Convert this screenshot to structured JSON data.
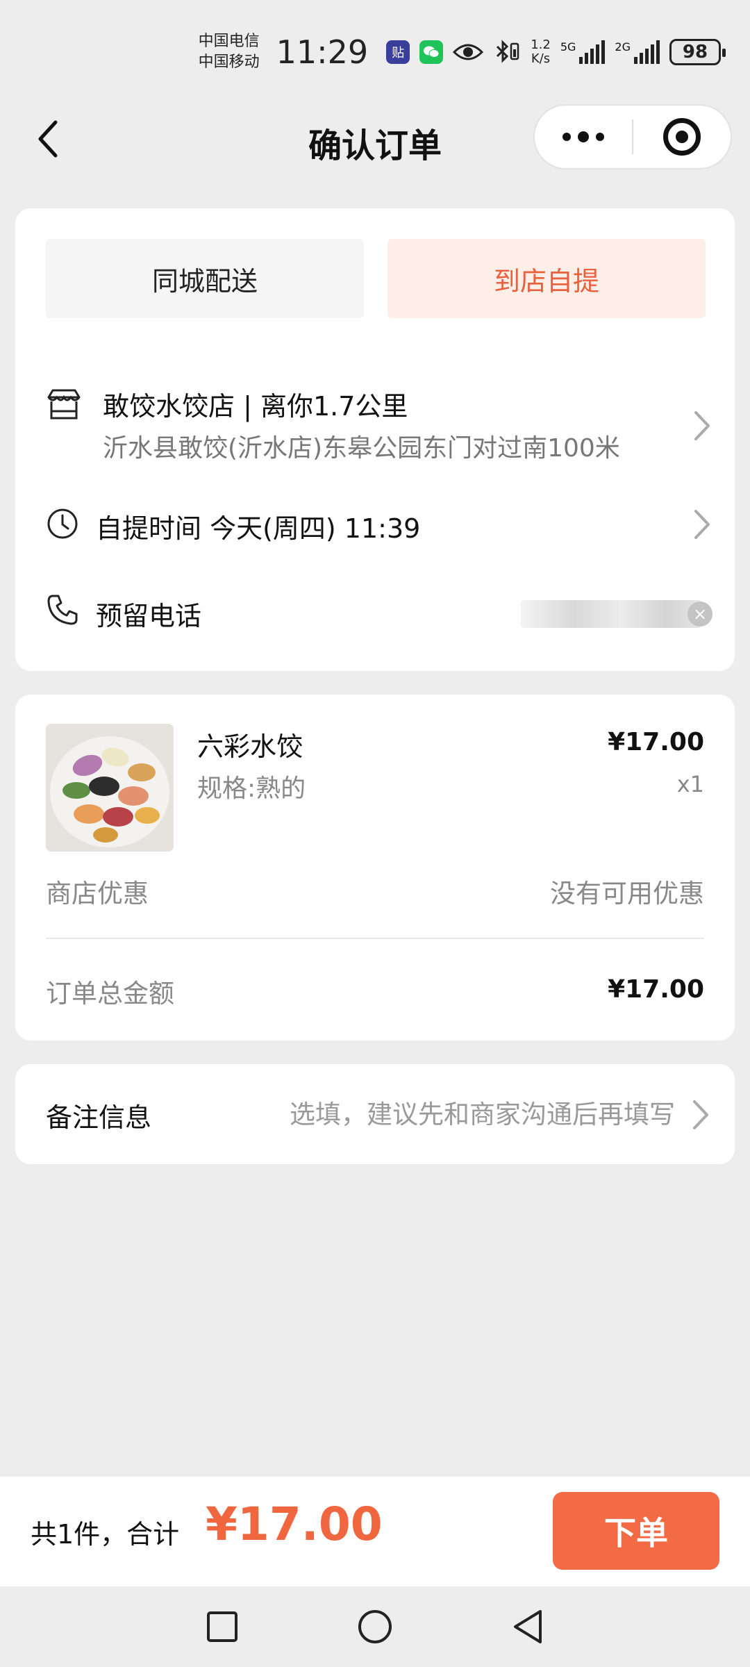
{
  "status_bar": {
    "carrier_1": "中国电信",
    "carrier_2": "中国移动",
    "time": "11:29",
    "app_badge_1": "贴",
    "net_speed_value": "1.2",
    "net_speed_unit": "K/s",
    "signal_1_tag": "5G",
    "signal_2_tag": "2G",
    "battery": "98"
  },
  "nav": {
    "title": "确认订单"
  },
  "delivery": {
    "tabs": [
      {
        "label": "同城配送",
        "active": false
      },
      {
        "label": "到店自提",
        "active": true
      }
    ],
    "store_name": "敢饺水饺店 | 离你1.7公里",
    "store_address": "沂水县敢饺(沂水店)东皋公园东门对过南100米",
    "pickup_time": "自提时间 今天(周四) 11:39",
    "phone_label": "预留电话",
    "clear_symbol": "×"
  },
  "order": {
    "product_name": "六彩水饺",
    "product_spec": "规格:熟的",
    "product_price": "¥17.00",
    "product_qty": "x1",
    "discount_label": "商店优惠",
    "discount_value": "没有可用优惠",
    "total_label": "订单总金额",
    "total_value": "¥17.00"
  },
  "remark": {
    "label": "备注信息",
    "placeholder": "选填，建议先和商家沟通后再填写"
  },
  "bottom_bar": {
    "summary": "共1件，合计",
    "amount": "¥17.00",
    "submit_label": "下单"
  },
  "colors": {
    "accent": "#f26b45",
    "active_tab_bg": "#fdeee8",
    "active_tab_text": "#e8603e",
    "page_bg": "#ededed"
  },
  "icons": {
    "back": "chevron-left-icon",
    "more": "more-dots-icon",
    "close_app": "target-icon",
    "store": "store-icon",
    "time": "clock-icon",
    "phone": "phone-icon",
    "arrow": "chevron-right-icon"
  }
}
